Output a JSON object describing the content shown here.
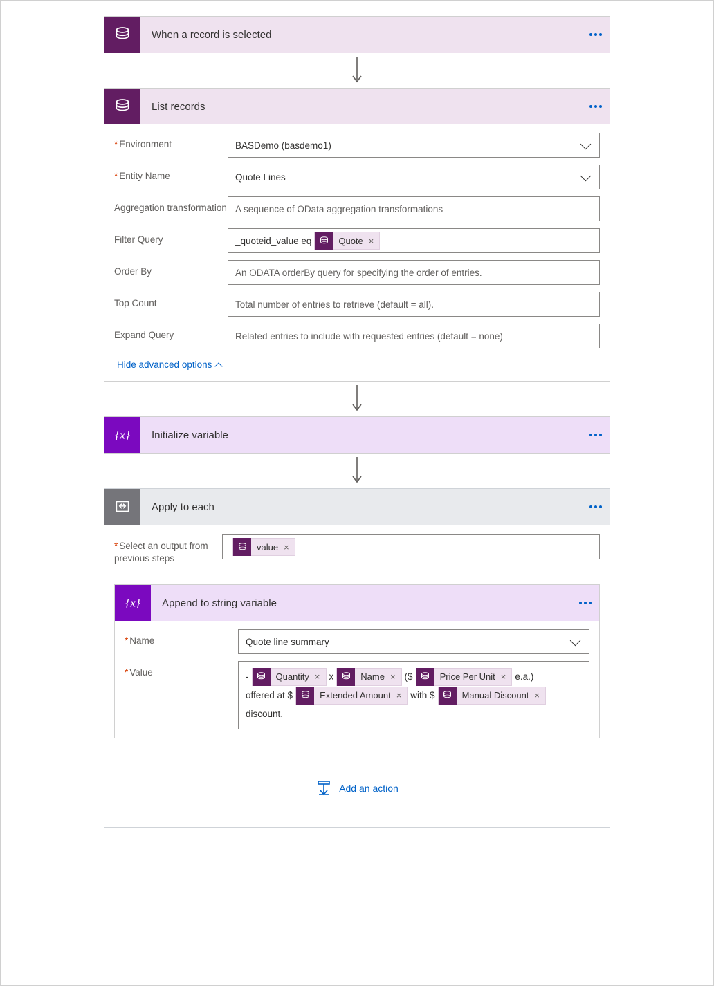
{
  "steps": {
    "trigger": {
      "title": "When a record is selected"
    },
    "listRecords": {
      "title": "List records",
      "fields": {
        "environment": {
          "label": "Environment",
          "value": "BASDemo (basdemo1)"
        },
        "entityName": {
          "label": "Entity Name",
          "value": "Quote Lines"
        },
        "aggregation": {
          "label": "Aggregation transformation",
          "placeholder": "A sequence of OData aggregation transformations"
        },
        "filterQuery": {
          "label": "Filter Query",
          "prefix": "_quoteid_value eq",
          "token": "Quote"
        },
        "orderBy": {
          "label": "Order By",
          "placeholder": "An ODATA orderBy query for specifying the order of entries."
        },
        "topCount": {
          "label": "Top Count",
          "placeholder": "Total number of entries to retrieve (default = all)."
        },
        "expandQuery": {
          "label": "Expand Query",
          "placeholder": "Related entries to include with requested entries (default = none)"
        }
      },
      "advancedToggle": "Hide advanced options"
    },
    "initVar": {
      "title": "Initialize variable"
    },
    "applyEach": {
      "title": "Apply to each",
      "selectLabel": "Select an output from previous steps",
      "selectToken": "value"
    },
    "append": {
      "title": "Append to string variable",
      "nameLabel": "Name",
      "nameValue": "Quote line summary",
      "valueLabel": "Value",
      "valueParts": {
        "t1": "- ",
        "tokQty": "Quantity",
        "t2": " x ",
        "tokName": "Name",
        "t3": " ($",
        "tokPrice": "Price Per Unit",
        "t4": " e.a.)",
        "t5": "offered at $",
        "tokExt": "Extended Amount",
        "t6": " with $",
        "tokDisc": "Manual Discount",
        "t7": "discount."
      }
    },
    "addAction": "Add an action"
  }
}
